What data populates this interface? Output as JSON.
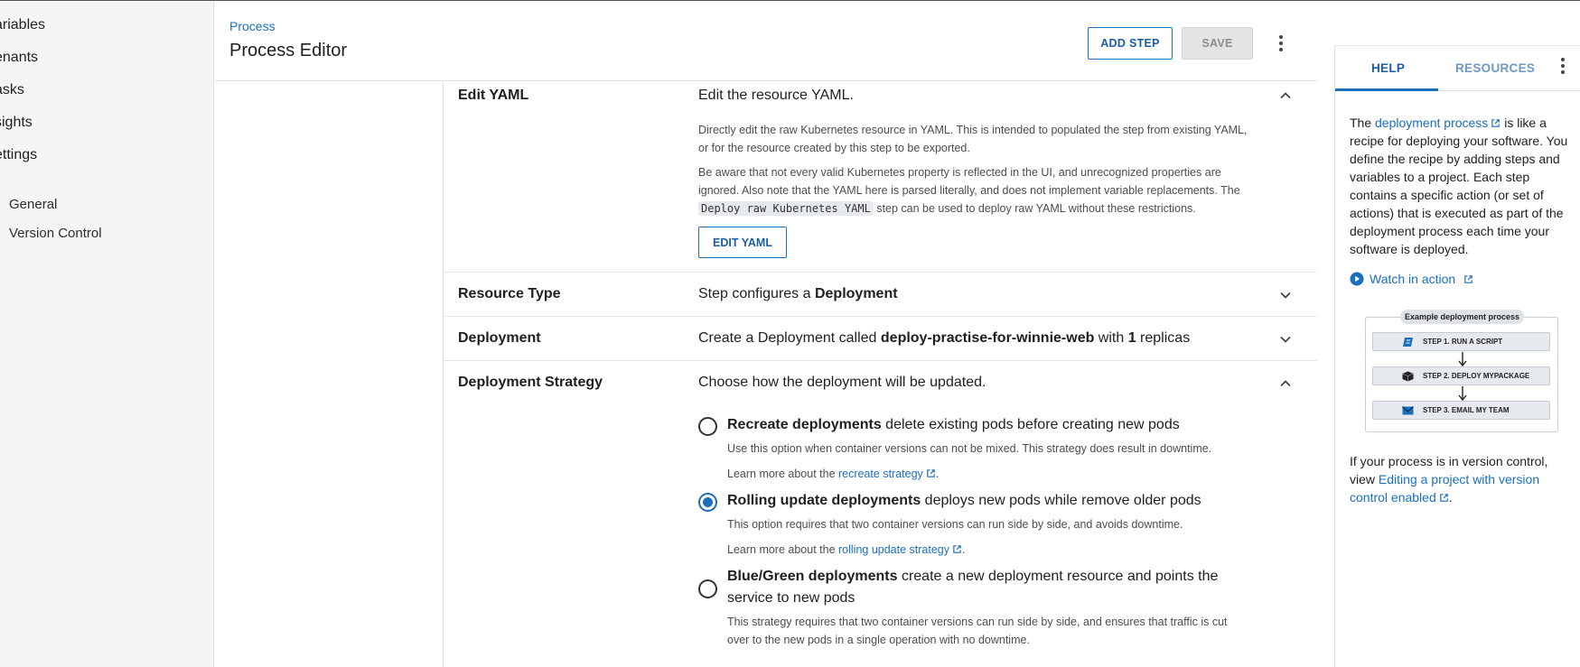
{
  "left_nav": {
    "items": [
      "ariables",
      "enants",
      "asks",
      "sights",
      "ettings"
    ],
    "sub_items": [
      "General",
      "Version Control"
    ]
  },
  "header": {
    "breadcrumb": "Process",
    "title": "Process Editor",
    "add_step_label": "ADD STEP",
    "save_label": "SAVE"
  },
  "sections": {
    "edit_yaml": {
      "label": "Edit YAML",
      "summary": "Edit the resource YAML.",
      "desc1": "Directly edit the raw Kubernetes resource in YAML. This is intended to populated the step from existing YAML, or for the resource created by this step to be exported.",
      "desc2_pre": "Be aware that not every valid Kubernetes property is reflected in the UI, and unrecognized properties are ignored. Also note that the YAML here is parsed literally, and does not implement variable replacements. The ",
      "desc2_code": "Deploy raw Kubernetes YAML",
      "desc2_post": " step can be used to deploy raw YAML without these restrictions.",
      "button_label": "EDIT YAML"
    },
    "resource_type": {
      "label": "Resource Type",
      "summary_pre": "Step configures a ",
      "summary_bold": "Deployment"
    },
    "deployment": {
      "label": "Deployment",
      "summary_pre": "Create a Deployment called ",
      "summary_name": "deploy-practise-for-winnie-web",
      "summary_mid": " with ",
      "summary_count": "1",
      "summary_post": " replicas"
    },
    "deployment_strategy": {
      "label": "Deployment Strategy",
      "summary": "Choose how the deployment will be updated.",
      "options": [
        {
          "title_bold": "Recreate deployments",
          "title_rest": " delete existing pods before creating new pods",
          "desc": "Use this option when container versions can not be mixed. This strategy does result in downtime.",
          "learn_pre": "Learn more about the ",
          "learn_link": "recreate strategy",
          "learn_post": "."
        },
        {
          "title_bold": "Rolling update deployments",
          "title_rest": " deploys new pods while remove older pods",
          "desc": "This option requires that two container versions can run side by side, and avoids downtime.",
          "learn_pre": "Learn more about the ",
          "learn_link": "rolling update strategy",
          "learn_post": "."
        },
        {
          "title_bold": "Blue/Green deployments",
          "title_rest": " create a new deployment resource and points the service to new pods",
          "desc": "This strategy requires that two container versions can run side by side, and ensures that traffic is cut over to the new pods in a single operation with no downtime."
        }
      ],
      "selected_index": 1
    }
  },
  "help_panel": {
    "tabs": [
      "HELP",
      "RESOURCES"
    ],
    "active_tab": "HELP",
    "intro_pre": "The ",
    "intro_link": "deployment process",
    "intro_post": " is like a recipe for deploying your software. You define the recipe by adding steps and variables to a project. Each step contains a specific action (or set of actions) that is executed as part of the deployment process each time your software is deployed.",
    "watch_label": "Watch in action",
    "diagram": {
      "title": "Example deployment process",
      "steps": [
        "STEP 1. RUN A SCRIPT",
        "STEP 2. DEPLOY MYPACKAGE",
        "STEP 3. EMAIL MY TEAM"
      ]
    },
    "vc_pre": "If your process is in version control, view ",
    "vc_link": "Editing a project with version control enabled",
    "vc_post": "."
  },
  "colors": {
    "accent": "#1a6fbf",
    "nav_background": "#f4f5f6",
    "disabled_button": "#e3e4e6"
  },
  "icons": [
    "chevron-up-icon",
    "chevron-down-icon",
    "more-vert-icon",
    "external-link-icon",
    "play-circle-icon",
    "script-icon",
    "package-icon",
    "email-icon",
    "arrow-down-icon"
  ]
}
